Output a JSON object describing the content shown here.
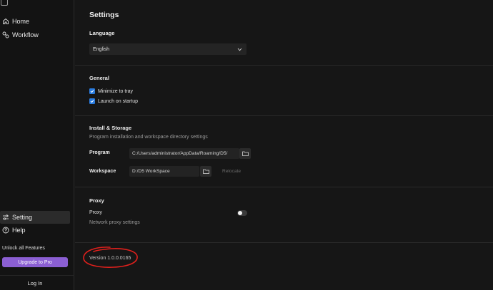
{
  "sidebar": {
    "items": [
      {
        "label": "Home",
        "icon": "home-icon"
      },
      {
        "label": "Workflow",
        "icon": "workflow-icon"
      }
    ],
    "bottom_items": [
      {
        "label": "Setting",
        "icon": "sliders-icon"
      },
      {
        "label": "Help",
        "icon": "help-icon"
      }
    ],
    "unlock_text": "Unlock all Features",
    "upgrade_label": "Upgrade to Pro",
    "login_label": "Log In"
  },
  "settings": {
    "title": "Settings",
    "language": {
      "heading": "Language",
      "selected": "English"
    },
    "general": {
      "heading": "General",
      "options": [
        {
          "label": "Minimize to tray",
          "checked": true
        },
        {
          "label": "Launch on startup",
          "checked": true
        }
      ]
    },
    "storage": {
      "heading": "Install & Storage",
      "description": "Program installation and workspace directory settings",
      "program_label": "Program",
      "program_path": "C:/Users/administrator/AppData/Roaming/D5/",
      "workspace_label": "Workspace",
      "workspace_path": "D:/D5 WorkSpace",
      "relocate_label": "Relocate"
    },
    "proxy": {
      "heading": "Proxy",
      "label": "Proxy",
      "description": "Network proxy settings",
      "enabled": false
    },
    "version": "Version 1.0.0.0165"
  },
  "colors": {
    "accent_purple": "#8b5fd3",
    "checkbox_blue": "#2a7ce0",
    "annotation_red": "#e0201c",
    "background": "#161616"
  }
}
